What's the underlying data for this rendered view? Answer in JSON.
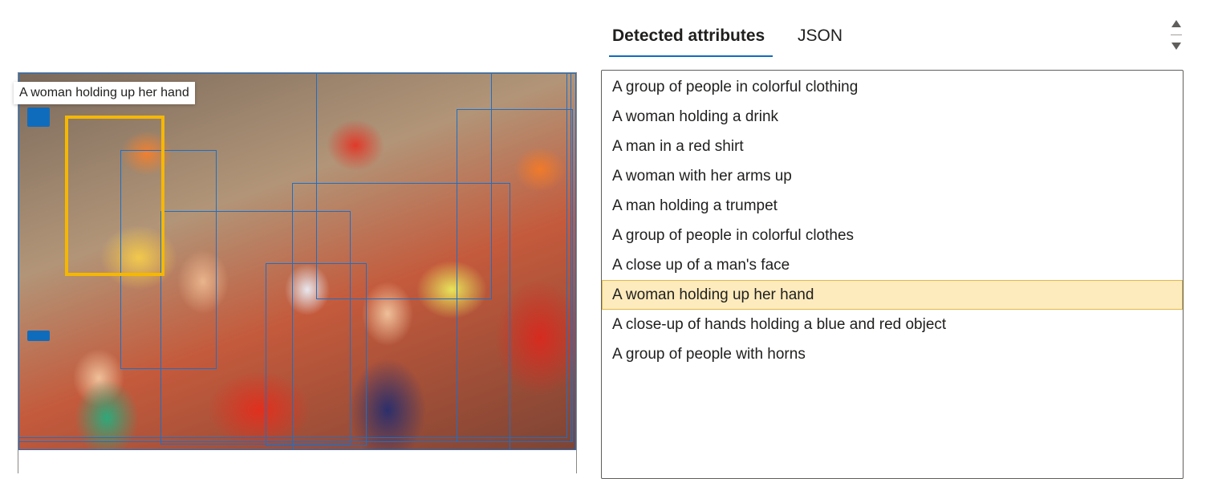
{
  "tabs": [
    {
      "label": "Detected attributes",
      "selected": true
    },
    {
      "label": "JSON",
      "selected": false
    }
  ],
  "tooltip": "A woman holding up her hand",
  "attributes": [
    "A group of people in colorful clothing",
    "A woman holding a drink",
    "A man in a red shirt",
    "A woman with her arms up",
    "A man holding a trumpet",
    "A group of people in colorful clothes",
    "A close up of a man's face",
    "A woman holding up her hand",
    "A close-up of hands holding a blue and red object",
    "A group of people with horns"
  ],
  "highlighted_index": 7,
  "colors": {
    "accent": "#0f6cbd",
    "box_stroke": "#1e6fc5",
    "selected_box": "#f5b800",
    "highlight_bg": "#fdebbd"
  },
  "icons": [
    "scroll-up-arrow-icon",
    "scroll-down-arrow-icon"
  ]
}
